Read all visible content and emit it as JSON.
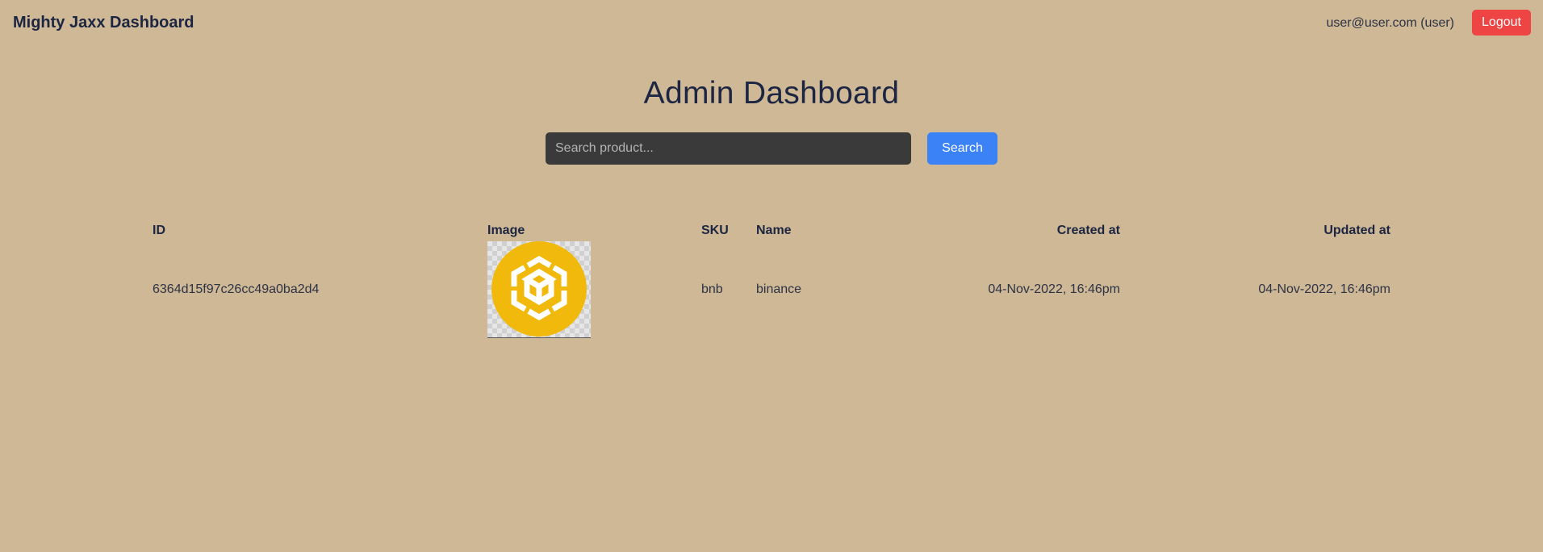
{
  "navbar": {
    "brand": "Mighty Jaxx Dashboard",
    "user_label": "user@user.com (user)",
    "logout_label": "Logout"
  },
  "page": {
    "title": "Admin Dashboard"
  },
  "search": {
    "placeholder": "Search product...",
    "value": "",
    "button_label": "Search"
  },
  "table": {
    "columns": {
      "id": "ID",
      "image": "Image",
      "sku": "SKU",
      "name": "Name",
      "created_at": "Created at",
      "updated_at": "Updated at"
    },
    "rows": [
      {
        "id": "6364d15f97c26cc49a0ba2d4",
        "image_icon": "binance-logo-icon",
        "sku": "bnb",
        "name": "binance",
        "created_at": "04-Nov-2022, 16:46pm",
        "updated_at": "04-Nov-2022, 16:46pm"
      }
    ]
  },
  "colors": {
    "background": "#cfb896",
    "text": "#1c2541",
    "logout": "#ef4444",
    "search_button": "#3b82f6",
    "search_input": "#3a3a3a",
    "binance_yellow": "#f0b90b"
  }
}
